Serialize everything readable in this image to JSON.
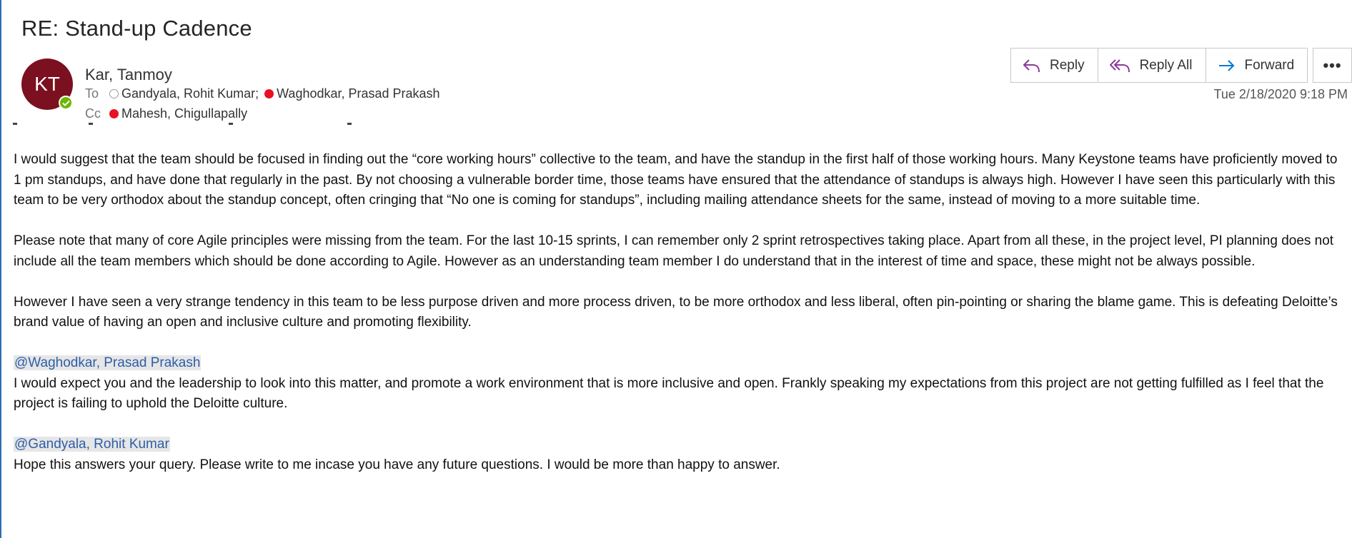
{
  "email": {
    "subject": "RE: Stand-up Cadence",
    "sender": {
      "name": "Kar, Tanmoy",
      "initials": "KT",
      "avatar_color": "#7a1020",
      "presence": "available"
    },
    "to_label": "To",
    "to": [
      {
        "name": "Gandyala, Rohit Kumar",
        "presence": "offline",
        "separator": ";"
      },
      {
        "name": "Waghodkar, Prasad Prakash",
        "presence": "busy",
        "separator": ""
      }
    ],
    "cc_label": "Cc",
    "cc": [
      {
        "name": "Mahesh, Chigullapally",
        "presence": "busy"
      }
    ],
    "timestamp": "Tue 2/18/2020 9:18 PM"
  },
  "actions": {
    "reply": "Reply",
    "reply_all": "Reply All",
    "forward": "Forward",
    "more": "•••"
  },
  "body": {
    "p1": "I would suggest that the team should be focused in finding out the “core working hours” collective to the team, and have the standup in the first half of those working hours. Many Keystone teams have proficiently moved to 1 pm standups, and have done that regularly in the past. By not choosing a vulnerable border time, those teams have ensured that the attendance of standups is always high. However I have seen this particularly with this team to be very orthodox about the standup concept, often cringing that “No one is coming for standups”, including mailing attendance sheets for the same, instead of moving to a more suitable time.",
    "p2": "Please note that many of core Agile principles were missing from the team. For the last 10-15 sprints, I can remember only 2 sprint retrospectives taking place. Apart from all these, in the project level, PI planning does not include all the team members which should be done according to Agile. However as an understanding team member I do understand that in the interest of time and space, these might not be always possible.",
    "p3": "However I have seen a very strange tendency in this team to be less purpose driven and more process driven, to be more orthodox and less liberal, often pin-pointing or sharing the blame game. This is defeating Deloitte’s brand value of having an open and inclusive culture and promoting flexibility.",
    "mention1": "@Waghodkar, Prasad Prakash",
    "p4": "I would expect you and the leadership to look into this matter, and promote a work environment that is more inclusive and open. Frankly speaking my expectations from this project are not getting fulfilled as I feel that the project is failing to uphold the Deloitte culture.",
    "mention2": "@Gandyala, Rohit Kumar",
    "p5": "Hope this answers your query. Please write to me incase you have any future questions. I would be more than happy to answer."
  },
  "colors": {
    "mention_text": "#2e5ea8",
    "mention_bg": "#e6e6e6",
    "busy": "#e81123",
    "available": "#6bb700",
    "icon_purple": "#8b3a9a",
    "icon_blue": "#0078d4"
  }
}
